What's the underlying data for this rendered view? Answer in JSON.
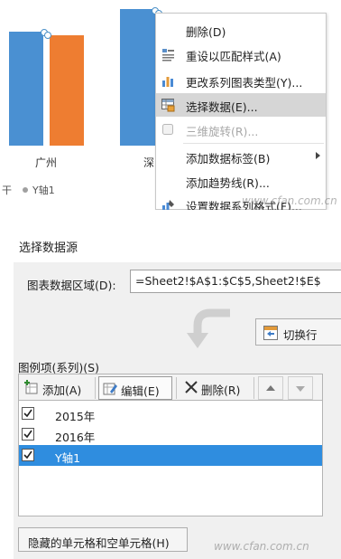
{
  "chart": {
    "bar_colors": {
      "blue": "#4a90d2",
      "orange": "#ee7d31"
    },
    "x_labels": [
      "广州",
      "深"
    ],
    "legend_fragment_left": "干",
    "legend_series_label": "Y轴1"
  },
  "context_menu": {
    "items": [
      {
        "label": "删除(D)",
        "icon": "none",
        "state": "normal"
      },
      {
        "label": "重设以匹配样式(A)",
        "icon": "reset-style-icon",
        "state": "normal"
      },
      {
        "label": "更改系列图表类型(Y)...",
        "icon": "chart-type-icon",
        "state": "normal"
      },
      {
        "label": "选择数据(E)...",
        "icon": "select-data-icon",
        "state": "highlighted"
      },
      {
        "label": "三维旋转(R)...",
        "icon": "rotate-3d-icon",
        "state": "disabled"
      },
      {
        "label": "添加数据标签(B)",
        "icon": "none",
        "state": "submenu"
      },
      {
        "label": "添加趋势线(R)...",
        "icon": "none",
        "state": "normal"
      },
      {
        "label": "设置数据系列格式(F)...",
        "icon": "format-series-icon",
        "state": "normal"
      }
    ],
    "highlight_color": "#d6d6d6"
  },
  "dialog": {
    "title": "选择数据源",
    "range_label": "图表数据区域(D):",
    "range_value": "=Sheet2!$A$1:$C$5,Sheet2!$E$",
    "switch_button": "切换行",
    "series_section_label": "图例项(系列)(S)",
    "toolbar": {
      "add": "添加(A)",
      "edit": "编辑(E)",
      "delete": "删除(R)"
    },
    "series": [
      {
        "name": "2015年",
        "checked": true,
        "selected": false
      },
      {
        "name": "2016年",
        "checked": true,
        "selected": false
      },
      {
        "name": "Y轴1",
        "checked": true,
        "selected": true
      }
    ],
    "hidden_cells_button": "隐藏的单元格和空单元格(H)",
    "selected_row_color": "#2f8ddf"
  },
  "watermarks": [
    "www.cfan.com.cn",
    "www.cfan.com.cn"
  ]
}
